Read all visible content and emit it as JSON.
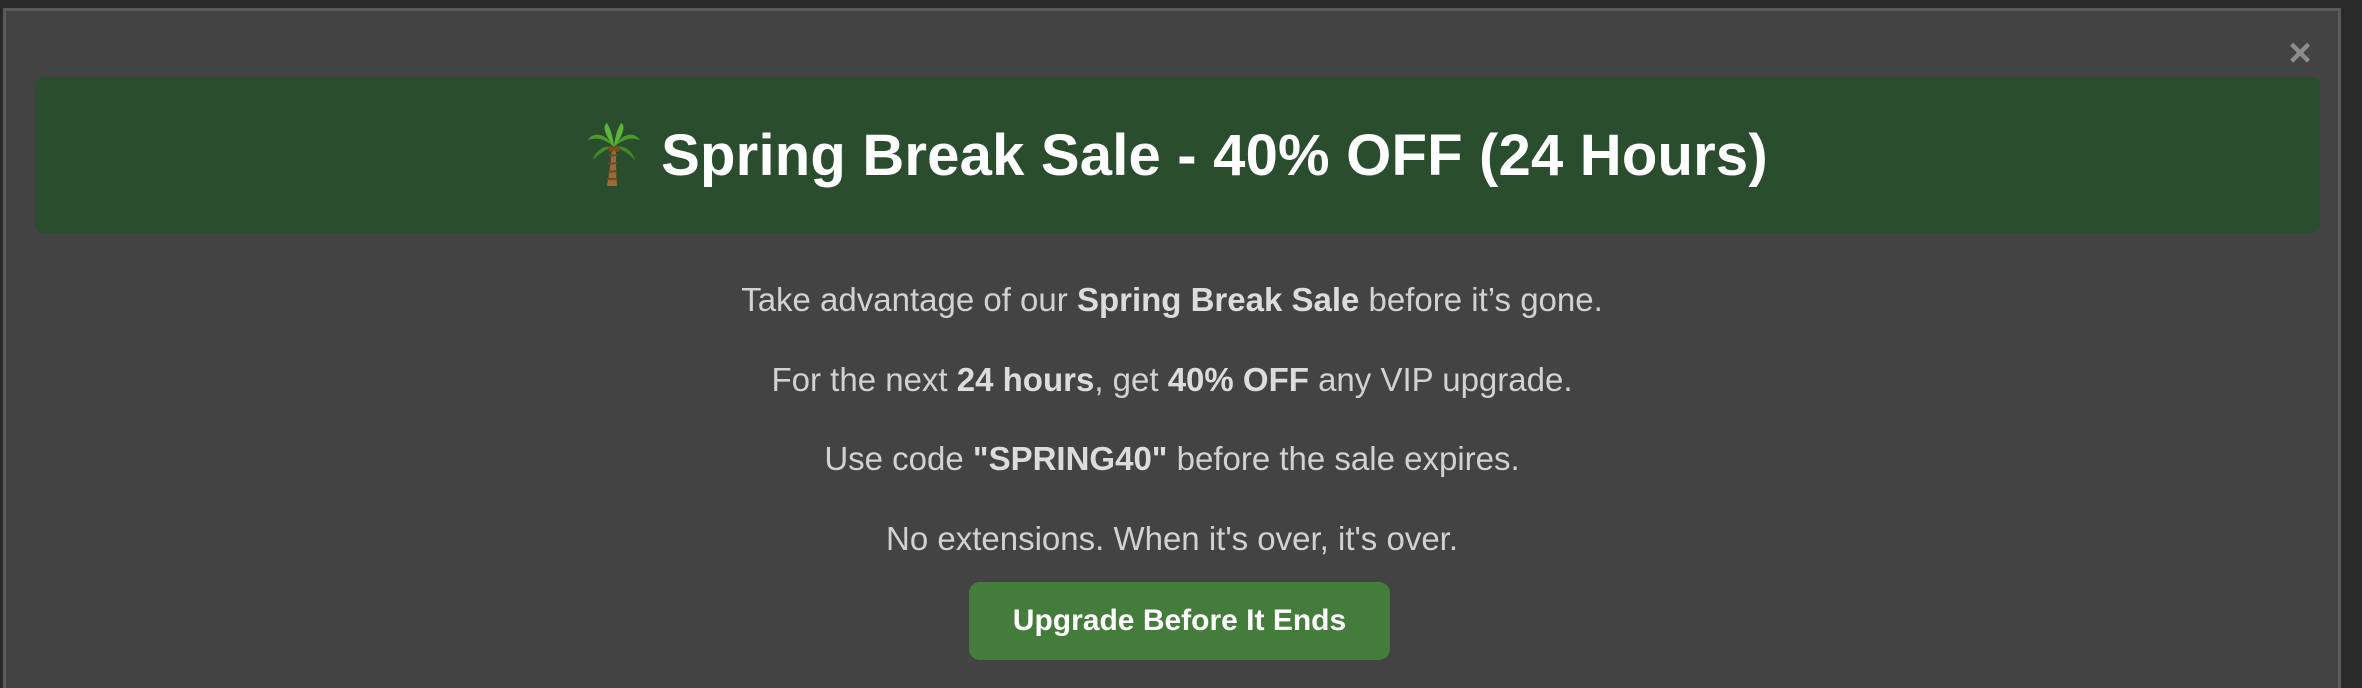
{
  "close_label": "×",
  "banner": {
    "title": "Spring Break Sale - 40% OFF (24 Hours)",
    "icon": "palm-tree-icon",
    "background": "#2a4d2e"
  },
  "body": {
    "line1": {
      "pre": "Take advantage of our ",
      "bold": "Spring Break Sale",
      "post": " before it’s gone."
    },
    "line2": {
      "pre": "For the next ",
      "bold1": "24 hours",
      "mid": ", get ",
      "bold2": "40% OFF",
      "post": " any VIP upgrade."
    },
    "line3": {
      "pre": "Use code ",
      "bold": "\"SPRING40\"",
      "post": " before the sale expires."
    },
    "line4": "No extensions. When it's over, it's over."
  },
  "cta": {
    "label": "Upgrade Before It Ends",
    "color": "#447d3b"
  }
}
